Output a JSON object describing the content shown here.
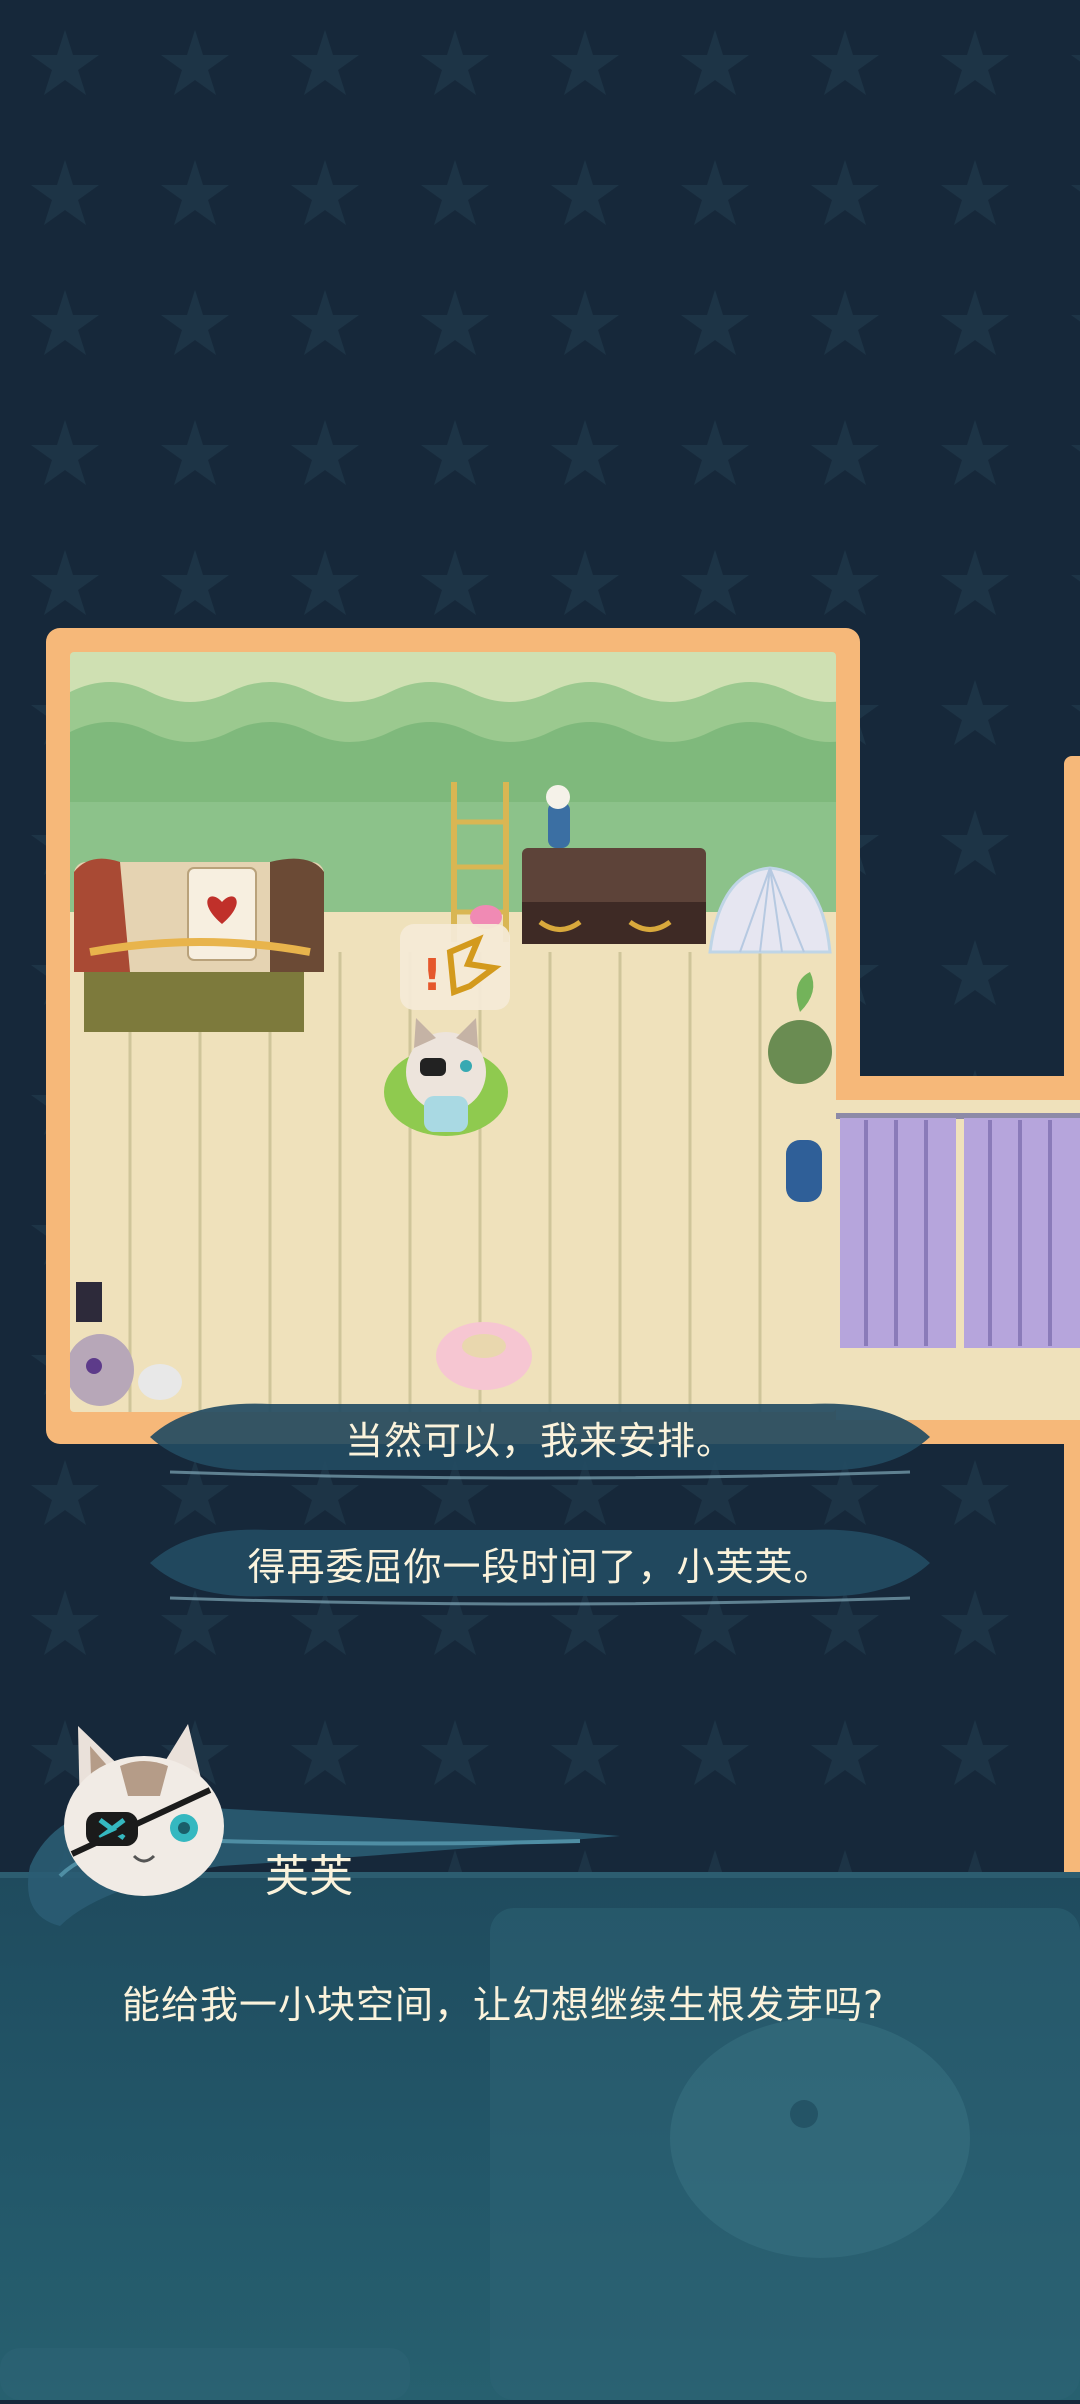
{
  "scene": {
    "choices": [
      {
        "label": "当然可以，我来安排。"
      },
      {
        "label": "得再委屈你一段时间了，小芙芙。"
      }
    ],
    "thought_bubble": {
      "symbols": "!"
    }
  },
  "dialog": {
    "speaker": "芙芙",
    "text": "能给我一小块空间，让幻想继续生根发芽吗?"
  },
  "colors": {
    "background": "#16283a",
    "room_frame": "#f6b879",
    "dialog_panel": "#23586a",
    "text": "#fbf3dc"
  }
}
